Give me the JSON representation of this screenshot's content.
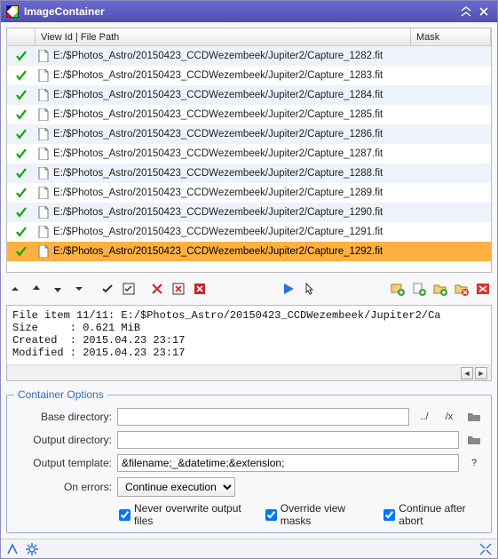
{
  "window": {
    "title": "ImageContainer"
  },
  "columns": {
    "check": "",
    "file": "View Id | File Path",
    "mask": "Mask"
  },
  "rows": [
    {
      "checked": true,
      "path": "E:/$Photos_Astro/20150423_CCDWezembeek/Jupiter2/Capture_1282.fit",
      "selected": false
    },
    {
      "checked": true,
      "path": "E:/$Photos_Astro/20150423_CCDWezembeek/Jupiter2/Capture_1283.fit",
      "selected": false
    },
    {
      "checked": true,
      "path": "E:/$Photos_Astro/20150423_CCDWezembeek/Jupiter2/Capture_1284.fit",
      "selected": false
    },
    {
      "checked": true,
      "path": "E:/$Photos_Astro/20150423_CCDWezembeek/Jupiter2/Capture_1285.fit",
      "selected": false
    },
    {
      "checked": true,
      "path": "E:/$Photos_Astro/20150423_CCDWezembeek/Jupiter2/Capture_1286.fit",
      "selected": false
    },
    {
      "checked": true,
      "path": "E:/$Photos_Astro/20150423_CCDWezembeek/Jupiter2/Capture_1287.fit",
      "selected": false
    },
    {
      "checked": true,
      "path": "E:/$Photos_Astro/20150423_CCDWezembeek/Jupiter2/Capture_1288.fit",
      "selected": false
    },
    {
      "checked": true,
      "path": "E:/$Photos_Astro/20150423_CCDWezembeek/Jupiter2/Capture_1289.fit",
      "selected": false
    },
    {
      "checked": true,
      "path": "E:/$Photos_Astro/20150423_CCDWezembeek/Jupiter2/Capture_1290.fit",
      "selected": false
    },
    {
      "checked": true,
      "path": "E:/$Photos_Astro/20150423_CCDWezembeek/Jupiter2/Capture_1291.fit",
      "selected": false
    },
    {
      "checked": true,
      "path": "E:/$Photos_Astro/20150423_CCDWezembeek/Jupiter2/Capture_1292.fit",
      "selected": true
    }
  ],
  "info": {
    "line1": "File item 11/11: E:/$Photos_Astro/20150423_CCDWezembeek/Jupiter2/Ca",
    "line2": "Size     : 0.621 MiB",
    "line3": "Created  : 2015.04.23 23:17",
    "line4": "Modified : 2015.04.23 23:17"
  },
  "options": {
    "legend": "Container Options",
    "base_dir_label": "Base directory:",
    "base_dir_value": "",
    "out_dir_label": "Output directory:",
    "out_dir_value": "",
    "out_tmpl_label": "Output template:",
    "out_tmpl_value": "&filename;_&datetime;&extension;",
    "on_errors_label": "On errors:",
    "on_errors_value": "Continue execution",
    "updir_btn": "../",
    "clear_btn": "/x",
    "help_btn": "?",
    "chk_overwrite": "Never overwrite output files",
    "chk_override_masks": "Override view masks",
    "chk_continue_abort": "Continue after abort"
  }
}
